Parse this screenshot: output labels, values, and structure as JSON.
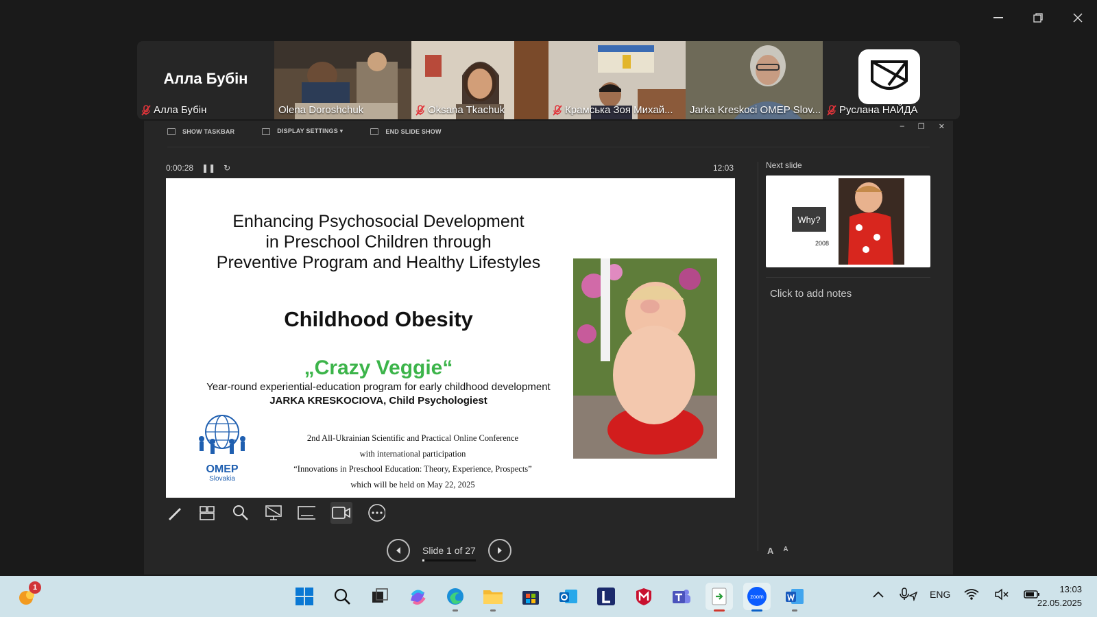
{
  "participants": [
    {
      "big_name": "Алла Бубін",
      "name": "Алла Бубін",
      "muted": true,
      "video": false
    },
    {
      "name": "Olena Doroshchuk",
      "muted": false,
      "video": true
    },
    {
      "name": "Oksana Tkachuk",
      "muted": true,
      "video": true
    },
    {
      "name": "Крамська Зоя Михай...",
      "muted": true,
      "video": true
    },
    {
      "name": "Jarka Kreskoci OMEP Slov...",
      "muted": false,
      "video": true,
      "active": true
    },
    {
      "name": "Руслана НАЙДА",
      "muted": true,
      "video": false
    }
  ],
  "slideshow": {
    "toolbar": {
      "show_taskbar": "SHOW TASKBAR",
      "display_settings": "DISPLAY SETTINGS ▾",
      "end_slide_show": "END SLIDE SHOW"
    },
    "elapsed": "0:00:28",
    "clock": "12:03",
    "slide": {
      "title_line1": "Enhancing Psychosocial Development",
      "title_line2": "in Preschool Children through",
      "title_line3": "Preventive Program and Healthy Lifestyles",
      "subtitle": "Childhood Obesity",
      "program_name": "„Crazy Veggie“",
      "program_desc": "Year-round experiential-education program for early childhood development",
      "author": "JARKA KRESKOCIOVA, Child Psychologiest",
      "conf_line1": "2nd All-Ukrainian Scientific and Practical Online Conference",
      "conf_line2": "with international participation",
      "conf_line3": "“Innovations in Preschool Education: Theory, Experience, Prospects”",
      "conf_line4": "which will be held on May 22, 2025",
      "logo_text": "OMEP",
      "logo_sub": "Slovakia"
    },
    "slide_counter": "Slide 1 of 27",
    "progress_fraction": 0.037,
    "next_slide_label": "Next slide",
    "next_slide": {
      "button": "Why?",
      "year": "2008"
    },
    "notes_placeholder": "Click to add notes",
    "font_larger": "A",
    "font_smaller": "A"
  },
  "taskbar": {
    "notification_count": "1",
    "language": "ENG",
    "time": "13:03",
    "date": "22.05.2025"
  },
  "colors": {
    "accent_green": "#3ccf7a",
    "veggie_green": "#3cb44a",
    "taskbar_bg": "#cfe3ea"
  }
}
